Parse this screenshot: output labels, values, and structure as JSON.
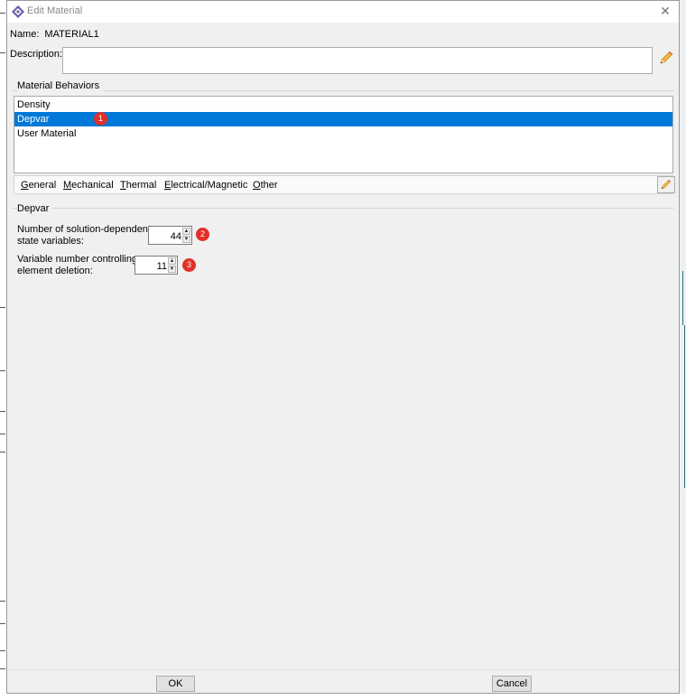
{
  "window": {
    "title": "Edit Material"
  },
  "material": {
    "name_label": "Name:",
    "name": "MATERIAL1"
  },
  "description": {
    "label": "Description:",
    "value": ""
  },
  "behaviors": {
    "group_title": "Material Behaviors",
    "items": [
      {
        "label": "Density",
        "selected": false
      },
      {
        "label": "Depvar",
        "selected": true,
        "badge": "1"
      },
      {
        "label": "User Material",
        "selected": false
      }
    ]
  },
  "menu": {
    "items": [
      {
        "u": "G",
        "rest": "eneral"
      },
      {
        "u": "M",
        "rest": "echanical"
      },
      {
        "u": "T",
        "rest": "hermal"
      },
      {
        "u": "E",
        "rest": "lectrical/Magnetic"
      },
      {
        "u": "O",
        "rest": "ther"
      }
    ]
  },
  "depvar": {
    "section_title": "Depvar",
    "num_state_vars": {
      "label_line1": "Number of solution-dependent",
      "label_line2": "state variables:",
      "value": "44",
      "badge": "2"
    },
    "deletion_var": {
      "label_line1": "Variable number controlling",
      "label_line2": "element deletion:",
      "value": "11",
      "badge": "3"
    }
  },
  "buttons": {
    "ok": "OK",
    "cancel": "Cancel"
  },
  "colors": {
    "selection": "#0078d7",
    "badge": "#e0302a"
  },
  "icons": {
    "app": "abaqus-diamond-icon",
    "close": "close-icon",
    "edit": "pencil-icon"
  }
}
